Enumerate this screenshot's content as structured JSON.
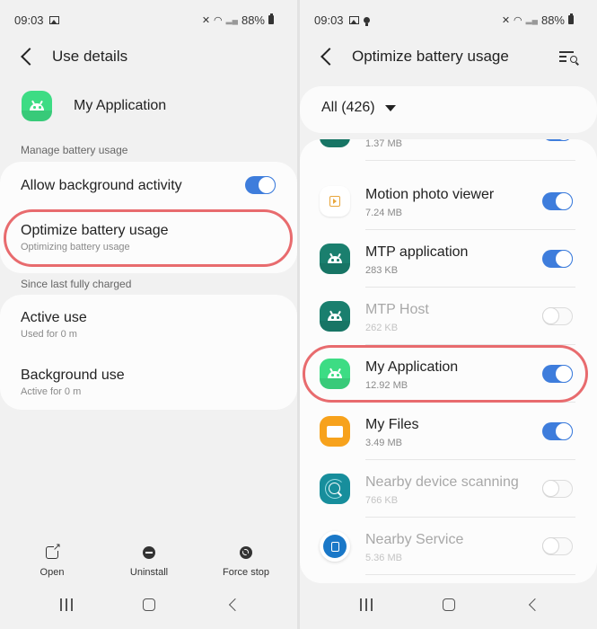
{
  "left_screen": {
    "status_bar": {
      "time": "09:03",
      "battery": "88%",
      "icons": [
        "gallery-icon",
        "mute-icon",
        "wifi-icon",
        "signal-icon",
        "battery-icon"
      ]
    },
    "header": {
      "title": "Use details"
    },
    "app": {
      "name": "My Application",
      "icon": "android-icon"
    },
    "manage_section": {
      "label": "Manage battery usage",
      "items": [
        {
          "title": "Allow background activity",
          "toggle": true
        },
        {
          "title": "Optimize battery usage",
          "subtitle": "Optimizing battery usage",
          "highlighted": true
        }
      ]
    },
    "since_section": {
      "label": "Since last fully charged",
      "items": [
        {
          "title": "Active use",
          "subtitle": "Used for 0 m"
        },
        {
          "title": "Background use",
          "subtitle": "Active for 0 m"
        }
      ]
    },
    "actions": [
      {
        "label": "Open",
        "icon": "open-external-icon"
      },
      {
        "label": "Uninstall",
        "icon": "minus-circle-icon"
      },
      {
        "label": "Force stop",
        "icon": "stop-circle-icon"
      }
    ]
  },
  "right_screen": {
    "status_bar": {
      "time": "09:03",
      "battery": "88%",
      "icons": [
        "gallery-icon",
        "bulb-icon",
        "mute-icon",
        "wifi-icon",
        "signal-icon",
        "battery-icon"
      ]
    },
    "header": {
      "title": "Optimize battery usage",
      "action_icon": "filter-search-icon"
    },
    "filter": {
      "label": "All (426)"
    },
    "apps": [
      {
        "name": "",
        "size": "1.37 MB",
        "icon": "android-icon",
        "optimized": true,
        "enabled": true
      },
      {
        "name": "Motion photo viewer",
        "size": "7.24 MB",
        "icon": "motion-photo-icon",
        "optimized": true,
        "enabled": true
      },
      {
        "name": "MTP application",
        "size": "283 KB",
        "icon": "android-icon",
        "optimized": true,
        "enabled": true
      },
      {
        "name": "MTP Host",
        "size": "262 KB",
        "icon": "android-icon",
        "optimized": false,
        "enabled": false
      },
      {
        "name": "My Application",
        "size": "12.92 MB",
        "icon": "android-icon",
        "optimized": true,
        "enabled": true,
        "highlighted": true
      },
      {
        "name": "My Files",
        "size": "3.49 MB",
        "icon": "folder-icon",
        "optimized": true,
        "enabled": true
      },
      {
        "name": "Nearby device scanning",
        "size": "766 KB",
        "icon": "nearby-scan-icon",
        "optimized": false,
        "enabled": false
      },
      {
        "name": "Nearby Service",
        "size": "5.36 MB",
        "icon": "nearby-service-icon",
        "optimized": false,
        "enabled": false
      }
    ]
  },
  "colors": {
    "toggle_on": "#3e7ddc",
    "highlight": "#e86b6e",
    "android_green": "#3ddc84",
    "android_dark": "#1a7f6e"
  }
}
